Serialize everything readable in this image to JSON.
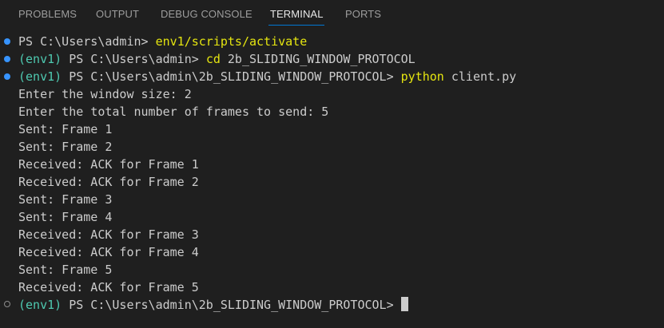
{
  "tabs": [
    {
      "label": "PROBLEMS",
      "active": false
    },
    {
      "label": "OUTPUT",
      "active": false
    },
    {
      "label": "DEBUG CONSOLE",
      "active": false
    },
    {
      "label": "TERMINAL",
      "active": true
    },
    {
      "label": "PORTS",
      "active": false
    }
  ],
  "terminal": {
    "cmd1": {
      "prompt": "PS C:\\Users\\admin> ",
      "command": "env1/scripts/activate"
    },
    "cmd2": {
      "env": "(env1) ",
      "prompt": "PS C:\\Users\\admin> ",
      "command": "cd",
      "args": " 2b_SLIDING_WINDOW_PROTOCOL"
    },
    "cmd3": {
      "env": "(env1) ",
      "prompt": "PS C:\\Users\\admin\\2b_SLIDING_WINDOW_PROTOCOL> ",
      "command": "python",
      "args": " client.py"
    },
    "output": [
      "Enter the window size: 2",
      "Enter the total number of frames to send: 5",
      "Sent: Frame 1",
      "Sent: Frame 2",
      "Received: ACK for Frame 1",
      "Received: ACK for Frame 2",
      "Sent: Frame 3",
      "Sent: Frame 4",
      "Received: ACK for Frame 3",
      "Received: ACK for Frame 4",
      "Sent: Frame 5",
      "Received: ACK for Frame 5"
    ],
    "final_prompt": {
      "env": "(env1) ",
      "prompt": "PS C:\\Users\\admin\\2b_SLIDING_WINDOW_PROTOCOL> "
    }
  },
  "colors": {
    "background": "#1f1f1f",
    "env": "#4ec9b0",
    "command": "#e5e510",
    "decoration_success": "#3794ff",
    "tab_active_underline": "#0078d4"
  }
}
